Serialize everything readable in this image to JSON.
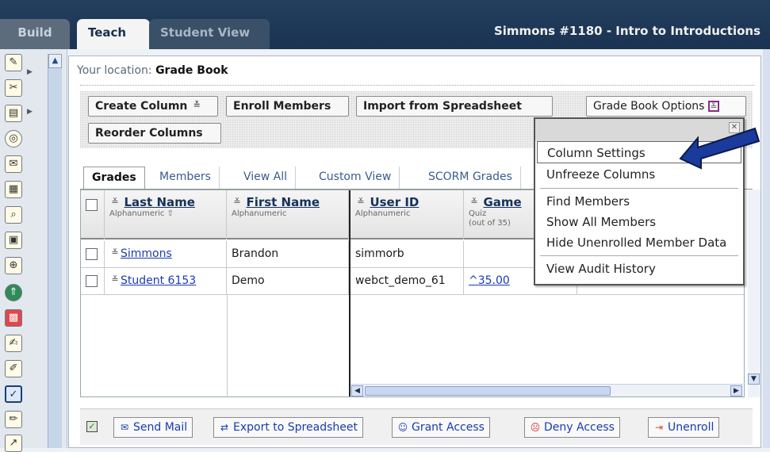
{
  "topbar": {
    "tabs": [
      {
        "label": "Build"
      },
      {
        "label": "Teach"
      },
      {
        "label": "Student View"
      }
    ],
    "course_title": "Simmons #1180 - Intro to Introductions"
  },
  "location": {
    "prefix": "Your location:",
    "current": "Grade Book"
  },
  "toolbar": {
    "create_column": "Create Column",
    "enroll_members": "Enroll Members",
    "import_spreadsheet": "Import from Spreadsheet",
    "reorder_columns": "Reorder Columns",
    "grade_book_options": "Grade Book Options"
  },
  "subtabs": [
    "Grades",
    "Members",
    "View All",
    "Custom View",
    "SCORM Grades"
  ],
  "grid": {
    "columns": [
      {
        "name": "Last Name",
        "sub": "Alphanumeric ⇧"
      },
      {
        "name": "First Name",
        "sub": "Alphanumeric"
      },
      {
        "name": "User ID",
        "sub": "Alphanumeric"
      },
      {
        "name": "Game",
        "sub": "Quiz",
        "sub2": "(out of 35)"
      }
    ],
    "rows": [
      {
        "last": "Simmons",
        "first": "Brandon",
        "userid": "simmorb",
        "game": ""
      },
      {
        "last": "Student 6153",
        "first": "Demo",
        "userid": "webct_demo_61",
        "game": "^35.00"
      }
    ]
  },
  "actionbar": {
    "send_mail": "Send Mail",
    "export": "Export to Spreadsheet",
    "grant": "Grant Access",
    "deny": "Deny Access",
    "unenroll": "Unenroll"
  },
  "popup_menu": {
    "items": [
      "Column Settings",
      "Unfreeze Columns",
      "Find Members",
      "Show All Members",
      "Hide Unenrolled Member Data",
      "View Audit History"
    ],
    "selected": "Column Settings"
  },
  "colors": {
    "topbar": "#1a3352",
    "link": "#1a3bb0",
    "arrow": "#1a3a9c"
  }
}
